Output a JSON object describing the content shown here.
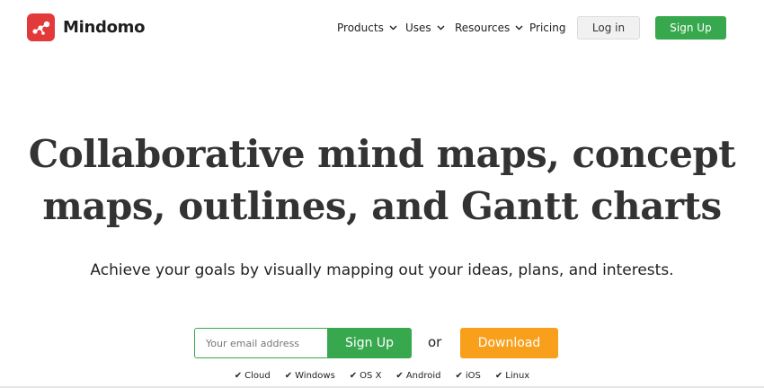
{
  "header": {
    "brand": "Mindomo",
    "logo_icon": "mindomo-logo-icon",
    "nav": [
      {
        "label": "Products",
        "has_dropdown": true
      },
      {
        "label": "Uses",
        "has_dropdown": true
      },
      {
        "label": "Resources",
        "has_dropdown": true
      },
      {
        "label": "Pricing",
        "has_dropdown": false
      }
    ],
    "login_label": "Log in",
    "signup_label": "Sign Up"
  },
  "hero": {
    "headline_line1": "Collaborative mind maps, concept",
    "headline_line2": "maps, outlines, and Gantt charts",
    "subheadline": "Achieve your goals by visually mapping out your ideas, plans, and interests."
  },
  "cta": {
    "email_placeholder": "Your email address",
    "email_value": "",
    "signup_label": "Sign Up",
    "or_label": "or",
    "download_label": "Download"
  },
  "platforms": [
    "Cloud",
    "Windows",
    "OS X",
    "Android",
    "iOS",
    "Linux"
  ],
  "colors": {
    "brand_red": "#e23a3a",
    "green": "#38a84e",
    "orange": "#f8a01c",
    "login_bg": "#f1f1f1"
  }
}
